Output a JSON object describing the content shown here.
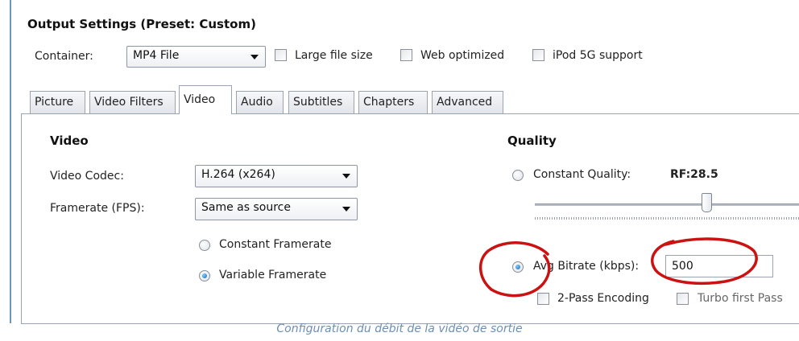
{
  "output_settings": {
    "title": "Output Settings (Preset: Custom)",
    "container_label": "Container:",
    "container_value": "MP4 File",
    "large_file_label": "Large file size",
    "web_optimized_label": "Web optimized",
    "ipod_label": "iPod 5G support"
  },
  "tabs": [
    {
      "label": "Picture"
    },
    {
      "label": "Video Filters"
    },
    {
      "label": "Video"
    },
    {
      "label": "Audio"
    },
    {
      "label": "Subtitles"
    },
    {
      "label": "Chapters"
    },
    {
      "label": "Advanced"
    }
  ],
  "active_tab": "Video",
  "video": {
    "title": "Video",
    "codec_label": "Video Codec:",
    "codec_value": "H.264 (x264)",
    "framerate_label": "Framerate (FPS):",
    "framerate_value": "Same as source",
    "constant_framerate": "Constant Framerate",
    "variable_framerate": "Variable Framerate",
    "selected_framerate_mode": "Variable Framerate"
  },
  "quality": {
    "title": "Quality",
    "constant_quality_label": "Constant Quality:",
    "rf_value": "RF:28.5",
    "avg_bitrate_label": "Avg Bitrate (kbps):",
    "avg_bitrate_value": "500",
    "two_pass_label": "2-Pass Encoding",
    "turbo_label": "Turbo first Pass",
    "selected_mode": "Avg Bitrate (kbps):"
  },
  "annotation_color": "#cc1111",
  "caption": "Configuration du débit de la vidéo de sortie"
}
